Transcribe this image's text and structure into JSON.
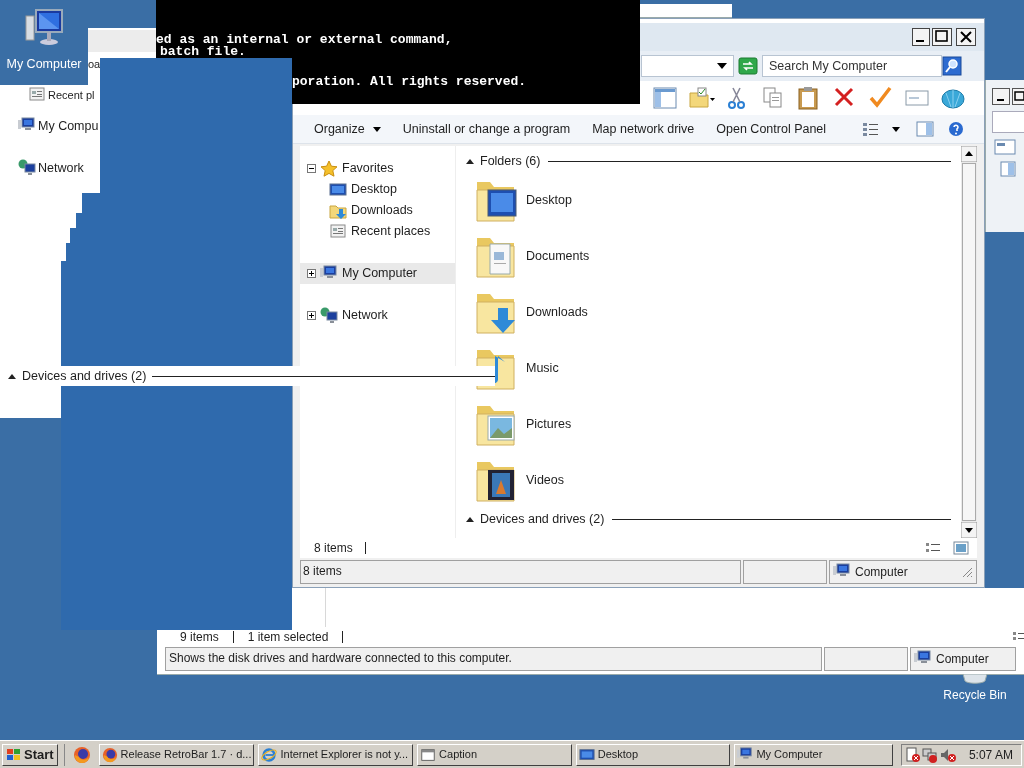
{
  "desktop_icons": [
    {
      "label": "My Computer",
      "kind": "computer"
    },
    {
      "label": "Recycle Bin",
      "kind": "recycle"
    }
  ],
  "back_window": {
    "nav_fragments": [
      {
        "label": "oa",
        "kind": "plain"
      },
      {
        "label": "Recent pl",
        "kind": "recent"
      },
      {
        "label": "My Compu",
        "kind": "computer"
      },
      {
        "label": "Network",
        "kind": "network"
      }
    ],
    "group_header": "Devices and drives (2)",
    "status_items": [
      "9 items",
      "1 item selected"
    ],
    "status_bar": {
      "text": "Shows the disk drives and hardware connected to this computer.",
      "location": "Computer"
    }
  },
  "console": {
    "lines": [
      "ed as an internal or external command,",
      "batch file.",
      "poration. All rights reserved."
    ]
  },
  "explorer": {
    "search": {
      "placeholder": "Search My Computer"
    },
    "commands": [
      "Organize",
      "Uninstall or change a program",
      "Map network drive",
      "Open Control Panel"
    ],
    "nav": [
      {
        "label": "Favorites",
        "kind": "favorites",
        "expanded": true,
        "selected": false,
        "children": [
          {
            "label": "Desktop",
            "kind": "desktop",
            "selected": false
          },
          {
            "label": "Downloads",
            "kind": "downloads",
            "selected": false
          },
          {
            "label": "Recent places",
            "kind": "recent",
            "selected": false
          }
        ]
      },
      {
        "label": "My Computer",
        "kind": "computer",
        "expanded": false,
        "selected": true
      },
      {
        "label": "Network",
        "kind": "network",
        "expanded": false,
        "selected": false
      }
    ],
    "groups": [
      {
        "header": "Folders (6)",
        "expanded": true,
        "items": [
          {
            "label": "Desktop",
            "kind": "desktop"
          },
          {
            "label": "Documents",
            "kind": "documents"
          },
          {
            "label": "Downloads",
            "kind": "downloads"
          },
          {
            "label": "Music",
            "kind": "music"
          },
          {
            "label": "Pictures",
            "kind": "pictures"
          },
          {
            "label": "Videos",
            "kind": "videos"
          }
        ]
      },
      {
        "header": "Devices and drives (2)",
        "expanded": true
      }
    ],
    "item_count": "8 items",
    "status_bar": {
      "text": "8 items",
      "location": "Computer"
    }
  },
  "taskbar": {
    "start": "Start",
    "tasks": [
      {
        "label": "Release RetroBar 1.7 · d...",
        "kind": "firefox",
        "selected": false
      },
      {
        "label": "Internet Explorer is not y...",
        "kind": "ie",
        "selected": false
      },
      {
        "label": "Caption",
        "kind": "window",
        "selected": false
      },
      {
        "label": "Desktop",
        "kind": "desktop",
        "selected": false
      },
      {
        "label": "My Computer",
        "kind": "computer",
        "selected": false
      }
    ],
    "clock": "5:07 AM"
  }
}
